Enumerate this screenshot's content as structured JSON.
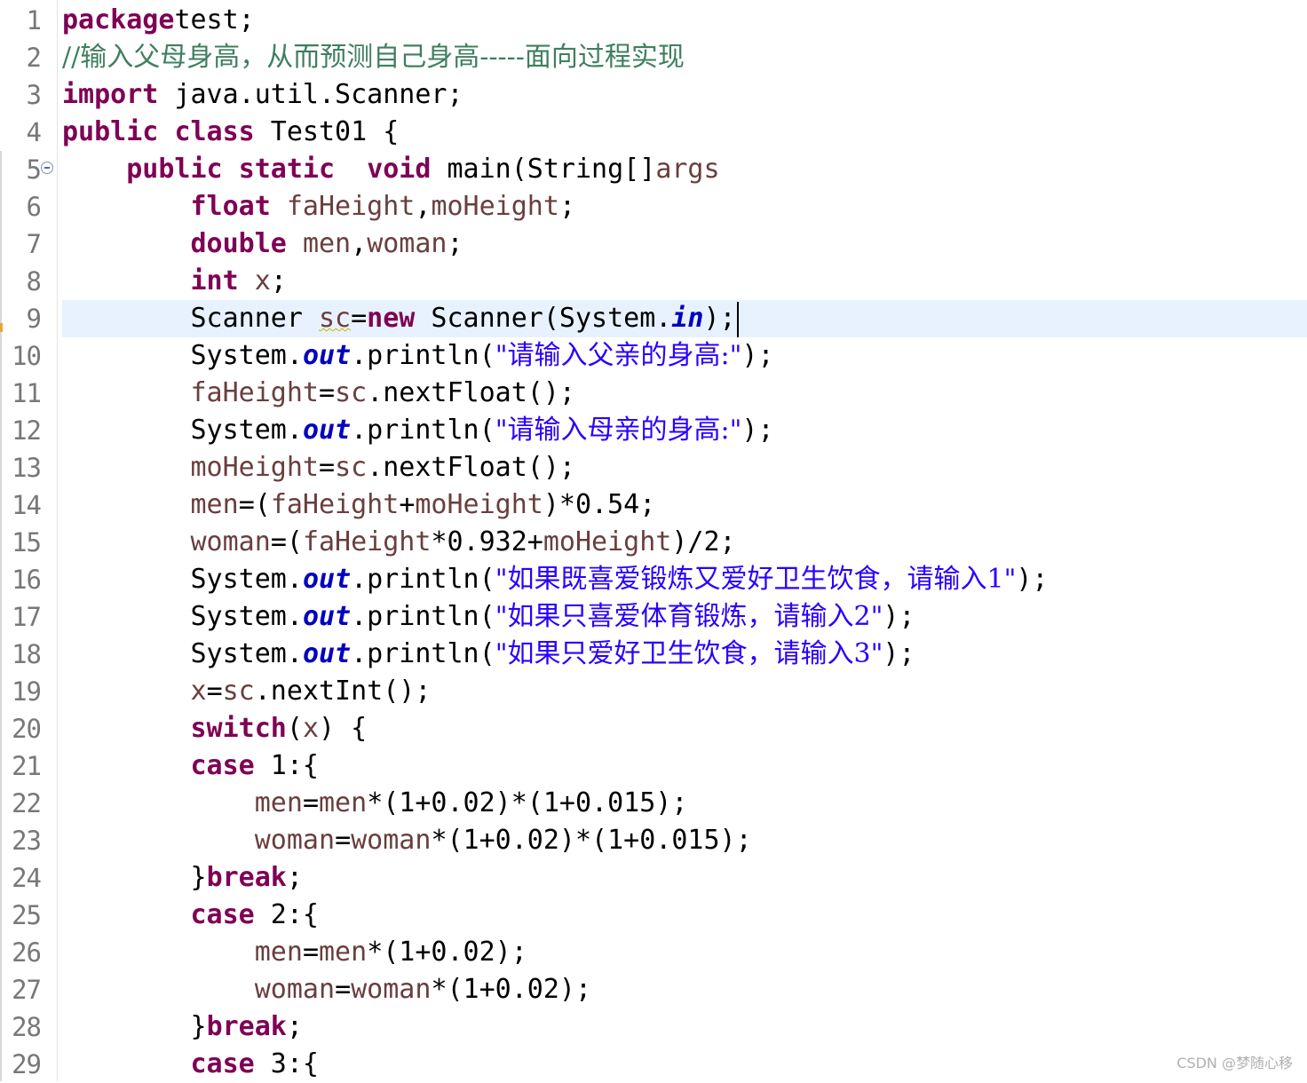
{
  "editor": {
    "current_line": 9,
    "lines": [
      {
        "n": "1",
        "tokens": [
          [
            "kw",
            "package"
          ],
          [
            "",
            "test;"
          ]
        ]
      },
      {
        "n": "2",
        "tokens": [
          [
            "cmt",
            "//输入父母身高，从而预测自己身高-----面向过程实现"
          ]
        ]
      },
      {
        "n": "3",
        "tokens": [
          [
            "kw",
            "import"
          ],
          [
            "",
            " java.util.Scanner;"
          ]
        ]
      },
      {
        "n": "4",
        "tokens": [
          [
            "kw",
            "public"
          ],
          [
            "",
            " "
          ],
          [
            "kw",
            "class"
          ],
          [
            "",
            " Test01 {"
          ]
        ]
      },
      {
        "n": "5",
        "fold": true,
        "tokens": [
          [
            "",
            "    "
          ],
          [
            "kw",
            "public"
          ],
          [
            "",
            " "
          ],
          [
            "kw",
            "static"
          ],
          [
            "",
            "  "
          ],
          [
            "kw",
            "void"
          ],
          [
            "",
            " main(String[]"
          ],
          [
            "var",
            "args"
          ],
          [
            ") {"
          ]
        ]
      },
      {
        "n": "6",
        "tokens": [
          [
            "",
            "        "
          ],
          [
            "kw",
            "float"
          ],
          [
            "",
            " "
          ],
          [
            "var",
            "faHeight"
          ],
          [
            "",
            ","
          ],
          [
            "var",
            "moHeight"
          ],
          [
            "",
            ";"
          ]
        ]
      },
      {
        "n": "7",
        "tokens": [
          [
            "",
            "        "
          ],
          [
            "kw",
            "double"
          ],
          [
            "",
            " "
          ],
          [
            "var",
            "men"
          ],
          [
            "",
            ","
          ],
          [
            "var",
            "woman"
          ],
          [
            "",
            ";"
          ]
        ]
      },
      {
        "n": "8",
        "tokens": [
          [
            "",
            "        "
          ],
          [
            "kw",
            "int"
          ],
          [
            "",
            " "
          ],
          [
            "var",
            "x"
          ],
          [
            "",
            ";"
          ]
        ]
      },
      {
        "n": "9",
        "tokens": [
          [
            "",
            "        Scanner "
          ],
          [
            "var warn",
            "sc"
          ],
          [
            "",
            "="
          ],
          [
            "kw",
            "new"
          ],
          [
            "",
            " Scanner(System."
          ],
          [
            "fld",
            "in"
          ],
          [
            "",
            ");"
          ]
        ]
      },
      {
        "n": "10",
        "tokens": [
          [
            "",
            "        System."
          ],
          [
            "fld",
            "out"
          ],
          [
            "",
            ".println("
          ],
          [
            "str",
            "\"请输入父亲的身高:\""
          ],
          [
            "",
            ");"
          ]
        ]
      },
      {
        "n": "11",
        "tokens": [
          [
            "",
            "        "
          ],
          [
            "var",
            "faHeight"
          ],
          [
            "",
            "="
          ],
          [
            "var",
            "sc"
          ],
          [
            "",
            ".nextFloat();"
          ]
        ]
      },
      {
        "n": "12",
        "tokens": [
          [
            "",
            "        System."
          ],
          [
            "fld",
            "out"
          ],
          [
            "",
            ".println("
          ],
          [
            "str",
            "\"请输入母亲的身高:\""
          ],
          [
            "",
            ");"
          ]
        ]
      },
      {
        "n": "13",
        "tokens": [
          [
            "",
            "        "
          ],
          [
            "var",
            "moHeight"
          ],
          [
            "",
            "="
          ],
          [
            "var",
            "sc"
          ],
          [
            "",
            ".nextFloat();"
          ]
        ]
      },
      {
        "n": "14",
        "tokens": [
          [
            "",
            "        "
          ],
          [
            "var",
            "men"
          ],
          [
            "",
            "=("
          ],
          [
            "var",
            "faHeight"
          ],
          [
            "",
            "+"
          ],
          [
            "var",
            "moHeight"
          ],
          [
            "",
            ")*0.54;"
          ]
        ]
      },
      {
        "n": "15",
        "tokens": [
          [
            "",
            "        "
          ],
          [
            "var",
            "woman"
          ],
          [
            "",
            "=("
          ],
          [
            "var",
            "faHeight"
          ],
          [
            "",
            "*0.932+"
          ],
          [
            "var",
            "moHeight"
          ],
          [
            "",
            ")/2;"
          ]
        ]
      },
      {
        "n": "16",
        "tokens": [
          [
            "",
            "        System."
          ],
          [
            "fld",
            "out"
          ],
          [
            "",
            ".println("
          ],
          [
            "str",
            "\"如果既喜爱锻炼又爱好卫生饮食，请输入1\""
          ],
          [
            "",
            ");"
          ]
        ]
      },
      {
        "n": "17",
        "tokens": [
          [
            "",
            "        System."
          ],
          [
            "fld",
            "out"
          ],
          [
            "",
            ".println("
          ],
          [
            "str",
            "\"如果只喜爱体育锻炼，请输入2\""
          ],
          [
            "",
            ");"
          ]
        ]
      },
      {
        "n": "18",
        "tokens": [
          [
            "",
            "        System."
          ],
          [
            "fld",
            "out"
          ],
          [
            "",
            ".println("
          ],
          [
            "str",
            "\"如果只爱好卫生饮食，请输入3\""
          ],
          [
            "",
            ");"
          ]
        ]
      },
      {
        "n": "19",
        "tokens": [
          [
            "",
            "        "
          ],
          [
            "var",
            "x"
          ],
          [
            "",
            "="
          ],
          [
            "var",
            "sc"
          ],
          [
            "",
            ".nextInt();"
          ]
        ]
      },
      {
        "n": "20",
        "tokens": [
          [
            "",
            "        "
          ],
          [
            "kw",
            "switch"
          ],
          [
            "",
            "("
          ],
          [
            "var",
            "x"
          ],
          [
            "",
            ") {"
          ]
        ]
      },
      {
        "n": "21",
        "tokens": [
          [
            "",
            "        "
          ],
          [
            "kw",
            "case"
          ],
          [
            "",
            " 1:{"
          ]
        ]
      },
      {
        "n": "22",
        "tokens": [
          [
            "",
            "            "
          ],
          [
            "var",
            "men"
          ],
          [
            "",
            "="
          ],
          [
            "var",
            "men"
          ],
          [
            "",
            "*(1+0.02)*(1+0.015);"
          ]
        ]
      },
      {
        "n": "23",
        "tokens": [
          [
            "",
            "            "
          ],
          [
            "var",
            "woman"
          ],
          [
            "",
            "="
          ],
          [
            "var",
            "woman"
          ],
          [
            "",
            "*(1+0.02)*(1+0.015);"
          ]
        ]
      },
      {
        "n": "24",
        "tokens": [
          [
            "",
            "        }"
          ],
          [
            "kw",
            "break"
          ],
          [
            "",
            ";"
          ]
        ]
      },
      {
        "n": "25",
        "tokens": [
          [
            "",
            "        "
          ],
          [
            "kw",
            "case"
          ],
          [
            "",
            " 2:{"
          ]
        ]
      },
      {
        "n": "26",
        "tokens": [
          [
            "",
            "            "
          ],
          [
            "var",
            "men"
          ],
          [
            "",
            "="
          ],
          [
            "var",
            "men"
          ],
          [
            "",
            "*(1+0.02);"
          ]
        ]
      },
      {
        "n": "27",
        "tokens": [
          [
            "",
            "            "
          ],
          [
            "var",
            "woman"
          ],
          [
            "",
            "="
          ],
          [
            "var",
            "woman"
          ],
          [
            "",
            "*(1+0.02);"
          ]
        ]
      },
      {
        "n": "28",
        "tokens": [
          [
            "",
            "        }"
          ],
          [
            "kw",
            "break"
          ],
          [
            "",
            ";"
          ]
        ]
      },
      {
        "n": "29",
        "tokens": [
          [
            "",
            "        "
          ],
          [
            "kw",
            "case"
          ],
          [
            "",
            " 3:{"
          ]
        ]
      }
    ]
  },
  "watermark": "CSDN @梦随心移"
}
